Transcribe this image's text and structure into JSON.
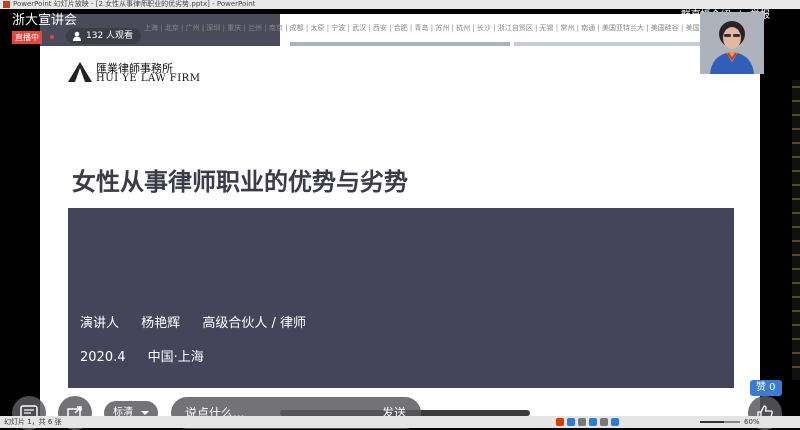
{
  "ppt_window": {
    "title": "PowerPoint 幻灯片放映 - [2.女性从事律师职业的优劣势.pptx] - PowerPoint"
  },
  "live": {
    "channel": "浙大宣讲会",
    "badge": "直播中",
    "viewers": "132 人观看",
    "links": [
      "群直播介绍",
      "举报"
    ]
  },
  "slide": {
    "cities": "上海 | 北京 | 广州 | 深圳 | 重庆 | 兰州 | 南京 | 成都 | 太原 | 宁波 | 武汉 | 西安 | 合肥 | 青岛 | 苏州 | 杭州 | 长沙 | 浙江自贸区 | 无锡 | 常州 | 南通 | 美国亚特兰大 | 美国硅谷 | 美国纽约",
    "firm_cn": "匯業律師事務所",
    "firm_en": "HUI YE LAW FIRM",
    "title": "女性从事律师职业的优势与劣势",
    "speaker_role": "演讲人",
    "speaker_name": "杨艳辉",
    "speaker_title": "高级合伙人 / 律师",
    "date": "2020.4",
    "place": "中国·上海",
    "band_colors": [
      "#4a4a5a",
      "#a9b4c2",
      "#c7ccd4"
    ]
  },
  "controls": {
    "quality_label": "标清",
    "comment_placeholder": "说点什么...",
    "send_label": "发送",
    "like_label": "赞 0"
  },
  "status_bar": {
    "text": "幻灯片 1，共 6 张",
    "zoom": "60%",
    "progress": 0.6
  }
}
